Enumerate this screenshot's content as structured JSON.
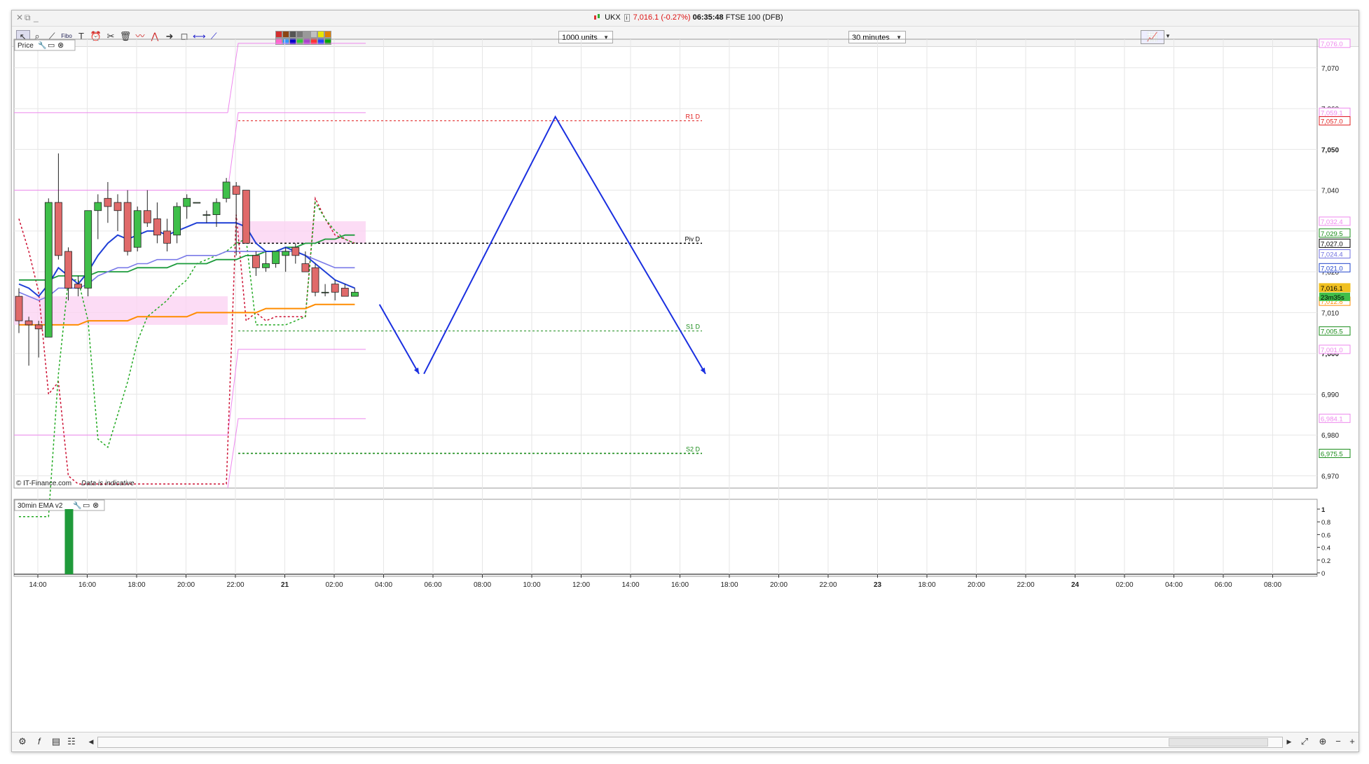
{
  "window": {
    "instrument": "UKX",
    "price": "7,016.1",
    "change": "(-0.27%)",
    "time": "06:35:48",
    "market": "FTSE 100 (DFB)"
  },
  "toolbar": {
    "units_value": "1000 units",
    "interval_value": "30 minutes",
    "icons": [
      "pointer-icon",
      "zoom-icon",
      "draw-line-icon",
      "fibonacci-icon",
      "text-icon",
      "alarm-icon",
      "tools-icon",
      "delete-icon",
      "pattern-icon",
      "pattern2-icon",
      "arrow-icon",
      "shape-icon",
      "hline-icon",
      "trendline-icon"
    ],
    "palette": [
      "#d32f2f",
      "#8b4513",
      "#555555",
      "#777777",
      "#999999",
      "#c0c0c0",
      "#e6e600",
      "#e08000",
      "#ff66cc",
      "#3399ff",
      "#0000cc",
      "#33cc33",
      "#aa44cc",
      "#ff3333",
      "#2244ff",
      "#00aa00"
    ]
  },
  "price_panel": {
    "title": "Price",
    "copyright": "© IT-Finance.com",
    "disclaimer": "Data is indicative",
    "levels": [
      {
        "label": "R1 D",
        "value": 7057.0,
        "color": "#e02020"
      },
      {
        "label": "Piv D",
        "value": 7027.0,
        "color": "#000000"
      },
      {
        "label": "S1 D",
        "value": 7005.5,
        "color": "#1a8c1a"
      },
      {
        "label": "S2 D",
        "value": 6975.5,
        "color": "#1a8c1a"
      }
    ],
    "price_tags": [
      {
        "text": "7,076.0",
        "value": 7076.0,
        "color": "#ee88ee"
      },
      {
        "text": "7,059.1",
        "value": 7059.1,
        "color": "#ee88ee"
      },
      {
        "text": "7,057.0",
        "value": 7057.0,
        "color": "#e02020"
      },
      {
        "text": "7,032.4",
        "value": 7032.4,
        "color": "#ee88ee"
      },
      {
        "text": "7,029.5",
        "value": 7029.5,
        "color": "#1a8c1a"
      },
      {
        "text": "7,027.0",
        "value": 7027.0,
        "color": "#000000"
      },
      {
        "text": "7,024.4",
        "value": 7024.4,
        "color": "#7070e0"
      },
      {
        "text": "7,021.0",
        "value": 7021.0,
        "color": "#2244cc"
      },
      {
        "text": "7,016.1",
        "value": 7016.1,
        "color": "#f0c020"
      },
      {
        "text": "7,012.8",
        "value": 7012.8,
        "color": "#ff8c00"
      },
      {
        "text": "7,005.5",
        "value": 7005.5,
        "color": "#1a8c1a"
      },
      {
        "text": "7,001.0",
        "value": 7001.0,
        "color": "#ee88ee"
      },
      {
        "text": "6,984.1",
        "value": 6984.1,
        "color": "#ee88ee"
      },
      {
        "text": "6,975.5",
        "value": 6975.5,
        "color": "#1a8c1a"
      }
    ],
    "countdown": "23m35s"
  },
  "indicator_panel": {
    "title": "30min EMA v2",
    "ticks": [
      "1",
      "0.8",
      "0.6",
      "0.4",
      "0.2",
      "0"
    ]
  },
  "chart_data": {
    "type": "candlestick",
    "ylim": [
      6967,
      7077
    ],
    "y_ticks": [
      6970,
      6980,
      6990,
      7000,
      7010,
      7020,
      7030,
      7040,
      7050,
      7060,
      7070
    ],
    "y_tick_labels": [
      "6,970",
      "6,980",
      "6,990",
      "7,000",
      "7,010",
      "7,020",
      "7,030",
      "7,040",
      "7,050",
      "7,060",
      "7,070"
    ],
    "x_tick_labels": [
      "14:00",
      "16:00",
      "18:00",
      "20:00",
      "22:00",
      "21",
      "02:00",
      "04:00",
      "06:00",
      "08:00",
      "10:00",
      "12:00",
      "14:00",
      "16:00",
      "18:00",
      "20:00",
      "22:00",
      "23",
      "18:00",
      "20:00",
      "22:00",
      "24",
      "02:00",
      "04:00",
      "06:00",
      "08:00"
    ],
    "candles": [
      {
        "o": 7014,
        "h": 7016,
        "l": 7005,
        "c": 7008
      },
      {
        "o": 7008,
        "h": 7009,
        "l": 6997,
        "c": 7007
      },
      {
        "o": 7007,
        "h": 7008,
        "l": 6999,
        "c": 7006
      },
      {
        "o": 7004,
        "h": 7038,
        "l": 7004,
        "c": 7037
      },
      {
        "o": 7037,
        "h": 7049,
        "l": 7023,
        "c": 7024
      },
      {
        "o": 7025,
        "h": 7026,
        "l": 7013,
        "c": 7016
      },
      {
        "o": 7017,
        "h": 7019,
        "l": 7014,
        "c": 7016
      },
      {
        "o": 7016,
        "h": 7035,
        "l": 7014,
        "c": 7035
      },
      {
        "o": 7035,
        "h": 7039,
        "l": 7028,
        "c": 7037
      },
      {
        "o": 7038,
        "h": 7042,
        "l": 7032,
        "c": 7036
      },
      {
        "o": 7037,
        "h": 7039,
        "l": 7030,
        "c": 7035
      },
      {
        "o": 7037,
        "h": 7040,
        "l": 7024,
        "c": 7025
      },
      {
        "o": 7026,
        "h": 7036,
        "l": 7025,
        "c": 7035
      },
      {
        "o": 7035,
        "h": 7040,
        "l": 7031,
        "c": 7032
      },
      {
        "o": 7033,
        "h": 7037,
        "l": 7027,
        "c": 7029
      },
      {
        "o": 7030,
        "h": 7033,
        "l": 7025,
        "c": 7027
      },
      {
        "o": 7029,
        "h": 7037,
        "l": 7027,
        "c": 7036
      },
      {
        "o": 7036,
        "h": 7039,
        "l": 7033,
        "c": 7038
      },
      {
        "o": 7037,
        "h": 7037,
        "l": 7037,
        "c": 7037
      },
      {
        "o": 7034,
        "h": 7035,
        "l": 7032,
        "c": 7034
      },
      {
        "o": 7034,
        "h": 7038,
        "l": 7031,
        "c": 7037
      },
      {
        "o": 7038,
        "h": 7043,
        "l": 7037,
        "c": 7042
      },
      {
        "o": 7041,
        "h": 7042,
        "l": 7024,
        "c": 7039
      },
      {
        "o": 7040,
        "h": 7040,
        "l": 7027,
        "c": 7027
      },
      {
        "o": 7024,
        "h": 7025,
        "l": 7019,
        "c": 7021
      },
      {
        "o": 7021,
        "h": 7025,
        "l": 7020,
        "c": 7022
      },
      {
        "o": 7022,
        "h": 7025,
        "l": 7021,
        "c": 7025
      },
      {
        "o": 7024,
        "h": 7026,
        "l": 7020,
        "c": 7025
      },
      {
        "o": 7026,
        "h": 7027,
        "l": 7022,
        "c": 7024
      },
      {
        "o": 7022,
        "h": 7025,
        "l": 7020,
        "c": 7020
      },
      {
        "o": 7021,
        "h": 7022,
        "l": 7014,
        "c": 7015
      },
      {
        "o": 7015,
        "h": 7017,
        "l": 7014,
        "c": 7015
      },
      {
        "o": 7017,
        "h": 7018,
        "l": 7013,
        "c": 7015
      },
      {
        "o": 7016,
        "h": 7017,
        "l": 7014,
        "c": 7014
      },
      {
        "o": 7014,
        "h": 7016,
        "l": 7014,
        "c": 7015
      }
    ],
    "ema_fast": [
      7017,
      7016,
      7014,
      7017,
      7021,
      7019,
      7017,
      7020,
      7024,
      7027,
      7029,
      7028,
      7029,
      7030,
      7030,
      7029,
      7030,
      7031,
      7032,
      7032,
      7032,
      7032,
      7032,
      7031,
      7027,
      7025,
      7025,
      7026,
      7025,
      7024,
      7022,
      7020,
      7018,
      7017,
      7016
    ],
    "ema_mid": [
      7015,
      7014,
      7013,
      7014,
      7016,
      7016,
      7016,
      7017,
      7019,
      7020,
      7021,
      7021,
      7022,
      7022,
      7023,
      7023,
      7023,
      7024,
      7024,
      7024,
      7024,
      7025,
      7025,
      7025,
      7025,
      7025,
      7025,
      7025,
      7025,
      7024,
      7023,
      7022,
      7021,
      7021,
      7021
    ],
    "ema_slow": [
      7018,
      7018,
      7018,
      7018,
      7019,
      7019,
      7019,
      7019,
      7020,
      7020,
      7020,
      7020,
      7021,
      7021,
      7021,
      7021,
      7022,
      7022,
      7022,
      7022,
      7023,
      7023,
      7023,
      7024,
      7024,
      7025,
      7025,
      7026,
      7026,
      7027,
      7027,
      7028,
      7028,
      7029,
      7029
    ],
    "ema_orange": [
      7007,
      7007,
      7007,
      7007,
      7007,
      7007,
      7007,
      7008,
      7008,
      7008,
      7008,
      7008,
      7009,
      7009,
      7009,
      7009,
      7009,
      7009,
      7010,
      7010,
      7010,
      7010,
      7010,
      7010,
      7010,
      7011,
      7011,
      7011,
      7011,
      7011,
      7012,
      7012,
      7012,
      7012,
      7012
    ],
    "sar_red": [
      7033,
      7025,
      7015,
      6990,
      6993,
      6970,
      6968,
      6968,
      6968,
      6968,
      6968,
      6968,
      6968,
      6968,
      6968,
      6968,
      6968,
      6968,
      6968,
      6968,
      6968,
      6968,
      7034,
      7008,
      7010,
      7008,
      7009,
      7009,
      7009,
      7009,
      7038,
      7033,
      7029,
      7028,
      7027
    ],
    "sar_green": [
      6960,
      6960,
      6960,
      6960,
      6995,
      7018,
      7018,
      7008,
      6979,
      6977,
      6985,
      6993,
      7003,
      7009,
      7011,
      7013,
      7016,
      7018,
      7022,
      7023,
      7024,
      7025,
      7027,
      7028,
      7007,
      7007,
      7007,
      7007,
      7008,
      7009,
      7037,
      7033,
      7030,
      7028,
      7027
    ],
    "pivot_bands": {
      "prev": {
        "r2": 7040,
        "r1": 7059,
        "s1": 6980,
        "s2": 7015,
        "s3": 7007
      },
      "curr": {
        "r3": 7076,
        "r2": 7059,
        "r1": 7032,
        "s1": 7001,
        "s2": 6984
      }
    },
    "projection": [
      {
        "x": 36.5,
        "y": 7012
      },
      {
        "x": 40.5,
        "y": 6995
      }
    ],
    "projection2": [
      {
        "x": 41.0,
        "y": 6995
      },
      {
        "x": 54.3,
        "y": 7058
      },
      {
        "x": 69.5,
        "y": 6995
      }
    ]
  }
}
